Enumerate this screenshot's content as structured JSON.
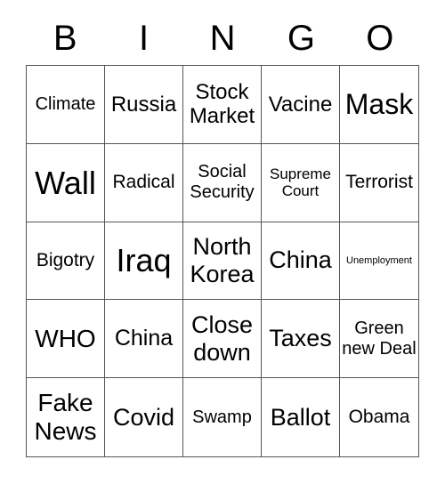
{
  "title_letters": [
    "B",
    "I",
    "N",
    "G",
    "O"
  ],
  "cells": [
    {
      "text": "Climate",
      "size": 20
    },
    {
      "text": "Russia",
      "size": 24
    },
    {
      "text": "Stock Market",
      "size": 24
    },
    {
      "text": "Vacine",
      "size": 24
    },
    {
      "text": "Mask",
      "size": 32
    },
    {
      "text": "Wall",
      "size": 36
    },
    {
      "text": "Radical",
      "size": 21
    },
    {
      "text": "Social Security",
      "size": 20
    },
    {
      "text": "Supreme Court",
      "size": 17
    },
    {
      "text": "Terrorist",
      "size": 21
    },
    {
      "text": "Bigotry",
      "size": 21
    },
    {
      "text": "Iraq",
      "size": 36
    },
    {
      "text": "North Korea",
      "size": 27
    },
    {
      "text": "China",
      "size": 27
    },
    {
      "text": "Unemployment",
      "size": 11
    },
    {
      "text": "WHO",
      "size": 28
    },
    {
      "text": "China",
      "size": 25
    },
    {
      "text": "Close down",
      "size": 27
    },
    {
      "text": "Taxes",
      "size": 27
    },
    {
      "text": "Green new Deal",
      "size": 20
    },
    {
      "text": "Fake News",
      "size": 28
    },
    {
      "text": "Covid",
      "size": 27
    },
    {
      "text": "Swamp",
      "size": 20
    },
    {
      "text": "Ballot",
      "size": 27
    },
    {
      "text": "Obama",
      "size": 21
    }
  ]
}
